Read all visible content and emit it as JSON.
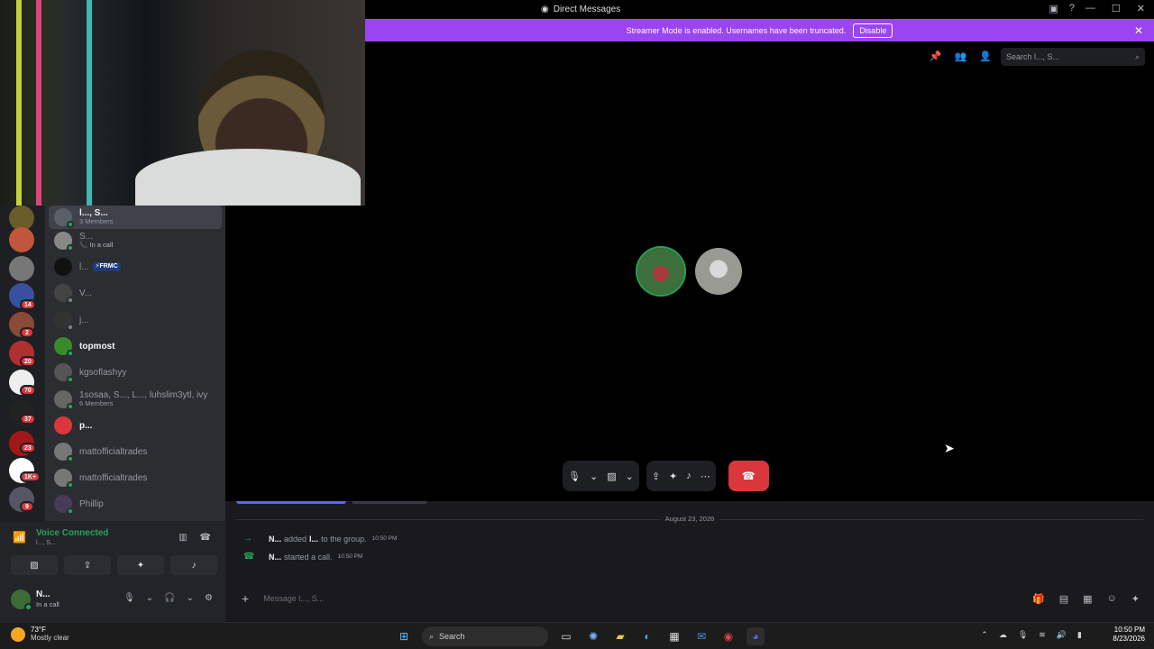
{
  "window": {
    "title": "Direct Messages",
    "colors": {
      "accent": "#5865f2",
      "online": "#23a55a",
      "danger": "#da373c",
      "banner": "#9b44f2"
    }
  },
  "banner": {
    "text": "Streamer Mode is enabled. Usernames have been truncated.",
    "disable_label": "Disable"
  },
  "server_rail": {
    "badges": [
      "14",
      "2",
      "20",
      "70",
      "37",
      "23",
      "1K+",
      "9"
    ]
  },
  "dm_list": [
    {
      "name": "l..., S...",
      "sub": "3 Members",
      "active": true
    },
    {
      "name": "S...",
      "sub": "In a call"
    },
    {
      "name": "l...",
      "tag": "⚡FRMC"
    },
    {
      "name": "V..."
    },
    {
      "name": "j..."
    },
    {
      "name": "topmost",
      "bold": true
    },
    {
      "name": "kgsoflashyy"
    },
    {
      "name": "1sosaa, S..., L..., luhslim3ytl, ivy",
      "sub": "6 Members"
    },
    {
      "name": "p...",
      "bold": true
    },
    {
      "name": "mattofficialtrades"
    },
    {
      "name": "mattofficialtrades"
    },
    {
      "name": "Phillip"
    }
  ],
  "voice_panel": {
    "title": "Voice Connected",
    "sub": "l..., S..."
  },
  "user_panel": {
    "name": "N...",
    "status": "In a call"
  },
  "call": {
    "search_placeholder": "Search l..., S..."
  },
  "chat": {
    "date": "August 23, 2026",
    "messages": [
      {
        "who": "N...",
        "text": "added",
        "target": "l...",
        "after": "to the group.",
        "time": "10:50 PM"
      },
      {
        "who": "N...",
        "text": "started a call.",
        "time": "10:50 PM"
      }
    ],
    "input_placeholder": "Message l..., S..."
  },
  "taskbar": {
    "temp": "73°F",
    "condition": "Mostly clear",
    "search_label": "Search",
    "time": "10:50 PM",
    "date": "8/23/2026"
  }
}
